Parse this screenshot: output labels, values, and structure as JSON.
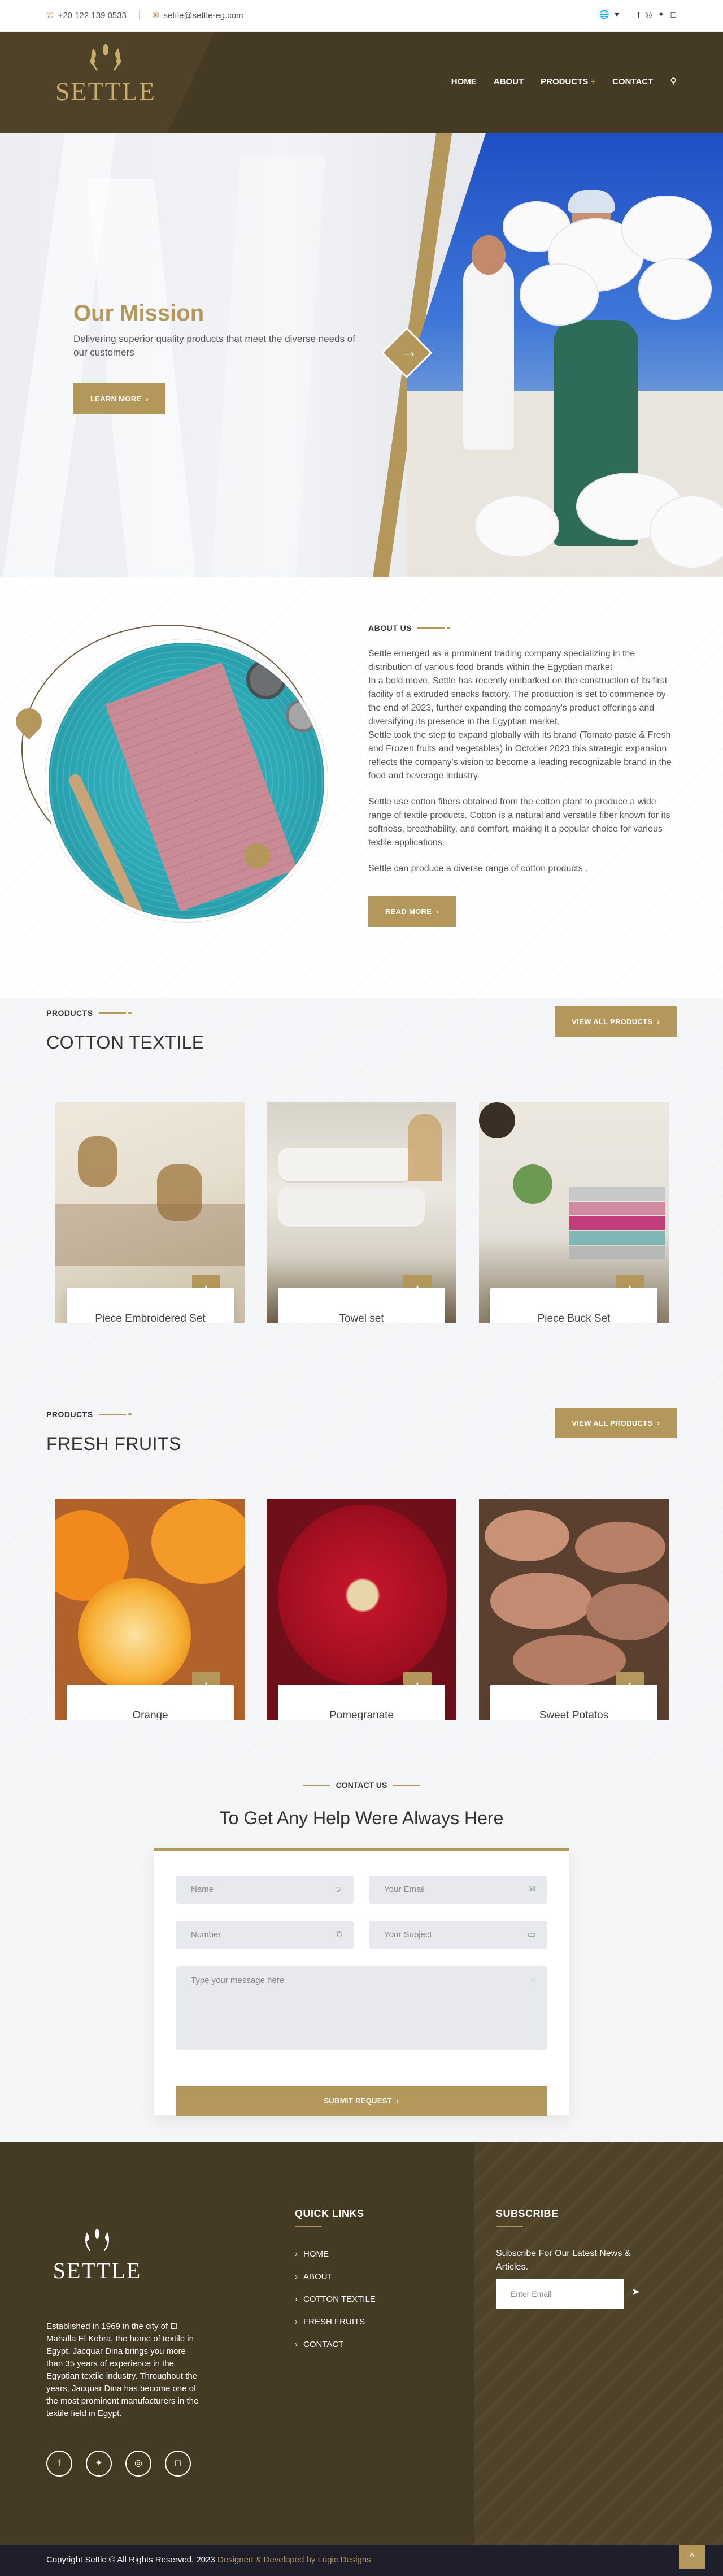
{
  "topbar": {
    "phone": "+20 122 139 0533",
    "email": "settle@settle-eg.com",
    "icons": [
      "phone-icon",
      "envelope-icon",
      "globe-icon",
      "facebook-icon",
      "whatsapp-icon",
      "twitter-icon",
      "instagram-icon"
    ],
    "lang_caret": "▾",
    "social_glyphs": [
      "f",
      "◎",
      "🐦",
      "◻"
    ]
  },
  "header": {
    "logo_text": "SETTLE",
    "nav": [
      "HOME",
      "ABOUT",
      "PRODUCTS",
      "CONTACT"
    ],
    "products_plus": "+"
  },
  "hero": {
    "title": "Our Mission",
    "subtitle": "Delivering superior quality products that meet the diverse needs of our customers",
    "button": "LEARN MORE",
    "arrow": "→"
  },
  "about": {
    "tag": "ABOUT US",
    "paragraphs": [
      "Settle emerged as a prominent trading company specializing in the distribution of various food brands within the Egyptian market\nIn a bold move, Settle has recently embarked on the construction of its first facility of a extruded snacks factory. The production is set to commence by the end of 2023, further expanding the company's product offerings and diversifying its presence in the Egyptian market.\nSettle took the step to expand globally with its brand (Tomato paste & Fresh and Frozen fruits and vegetables) in October 2023 this strategic expansion reflects the company's vision to become a leading recognizable brand in the food and beverage industry.",
      "Settle use cotton fibers obtained from the cotton plant to produce a wide range of textile products. Cotton is a natural and versatile fiber known for its softness, breathability, and comfort, making it a popular choice for various textile applications.",
      "Settle can produce a diverse range of cotton products ."
    ],
    "button": "READ MORE"
  },
  "cotton": {
    "tag": "PRODUCTS",
    "title": "COTTON TEXTILE",
    "view_all": "VIEW ALL PRODUCTS",
    "items": [
      {
        "name": "Piece Embroidered Set"
      },
      {
        "name": "Towel set"
      },
      {
        "name": "Piece Buck Set"
      }
    ]
  },
  "fruits": {
    "tag": "PRODUCTS",
    "title": "FRESH FRUITS",
    "view_all": "VIEW ALL PRODUCTS",
    "items": [
      {
        "name": "Orange"
      },
      {
        "name": "Pomegranate"
      },
      {
        "name": "Sweet Potatos"
      }
    ]
  },
  "contact": {
    "tag": "CONTACT US",
    "title": "To Get Any Help Were Always Here",
    "name_placeholder": "Name",
    "email_placeholder": "Your Email",
    "number_placeholder": "Number",
    "subject_placeholder": "Your  Subject",
    "message_placeholder": "Type your message here",
    "submit": "SUBMIT REQUEST"
  },
  "footer": {
    "logo_text": "SETTLE",
    "about": "Established in 1969 in the city of El Mahalla El Kobra, the home of textile in Egypt. Jacquar Dina brings you more than 35 years of experience in the Egyptian textile industry. Throughout the years, Jacquar Dina has become one of the most prominent manufacturers in the textile field in Egypt.",
    "quick_title": "QUICK LINKS",
    "quick_links": [
      "HOME",
      "ABOUT",
      "COTTON TEXTILE",
      "FRESH FRUITS",
      "CONTACT"
    ],
    "subscribe_title": "SUBSCRIBE",
    "subscribe_text": "Subscribe For Our Latest News & Articles.",
    "subscribe_placeholder": "Enter Email",
    "social_glyphs": [
      "f",
      "🐦",
      "◎",
      "◻"
    ]
  },
  "copyright": {
    "text": "Copyright Settle © All Rights Reserved.  2023",
    "credit": "Designed & Developed by Logic Designs"
  },
  "colors": {
    "accent": "#b4975a",
    "dark": "#453a24",
    "copybar": "#1e1f2a"
  }
}
